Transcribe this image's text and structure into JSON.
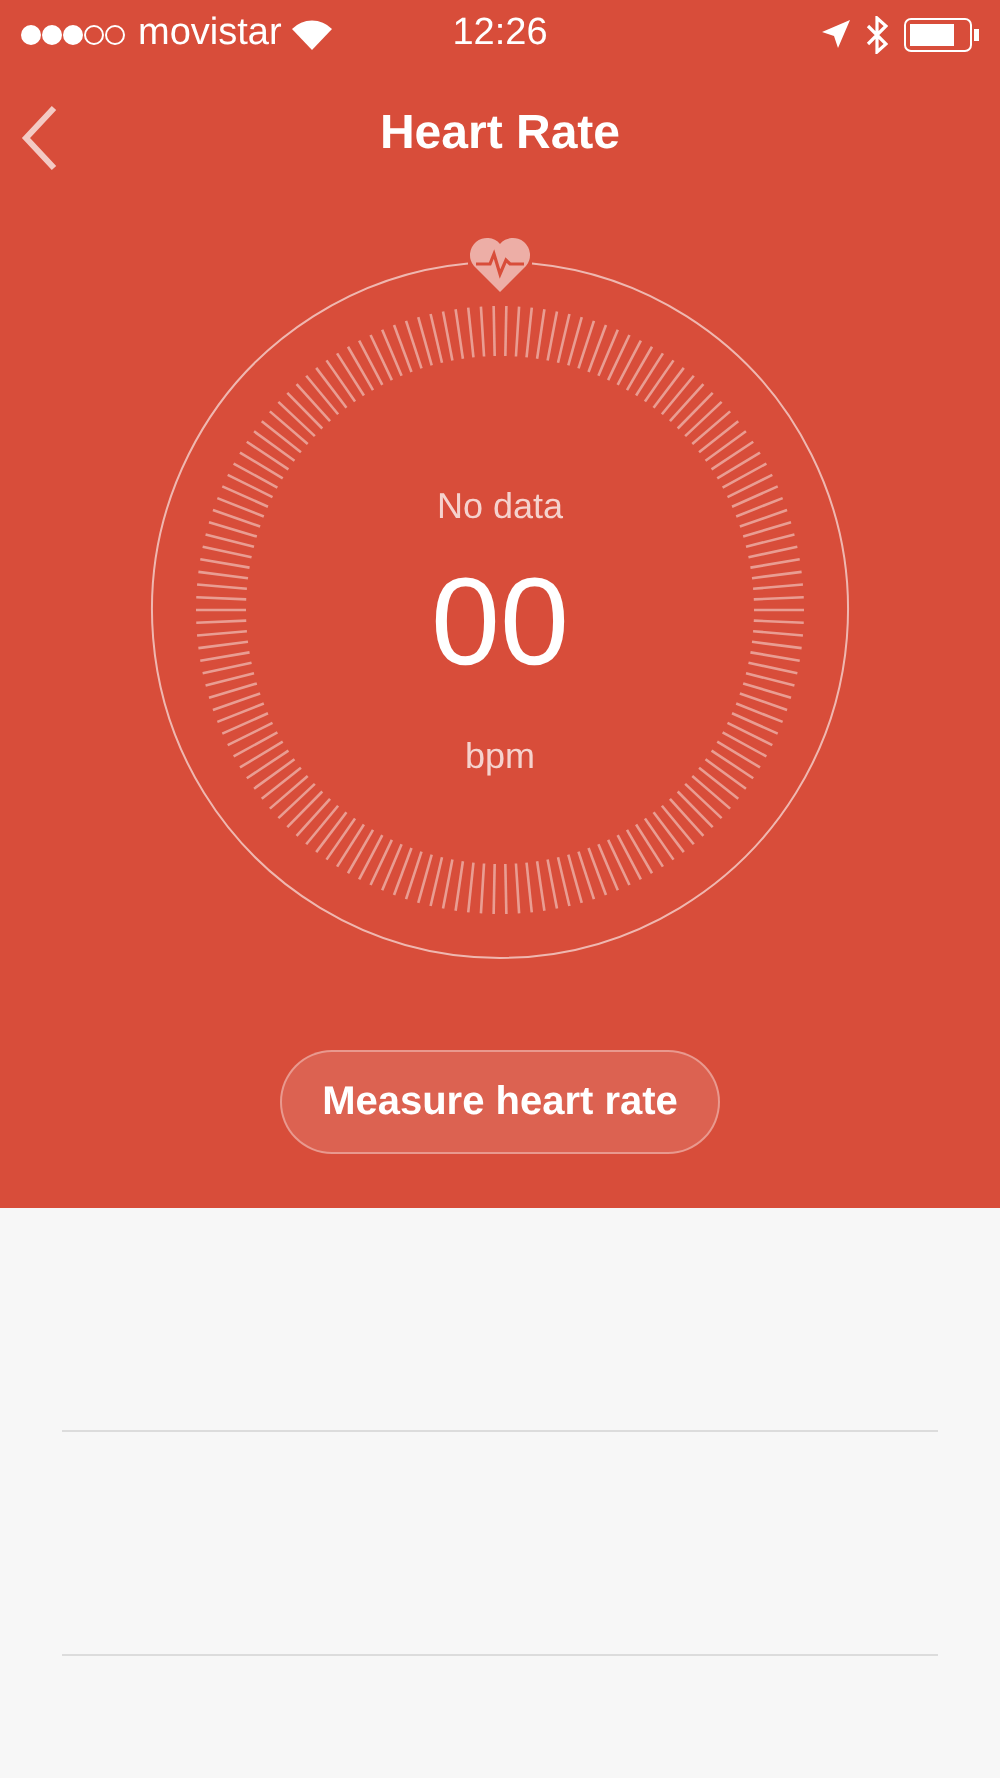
{
  "status_bar": {
    "carrier": "movistar",
    "time": "12:26"
  },
  "nav": {
    "title": "Heart Rate"
  },
  "gauge": {
    "status": "No data",
    "value": "00",
    "unit": "bpm"
  },
  "measure_button": {
    "label": "Measure heart rate"
  }
}
